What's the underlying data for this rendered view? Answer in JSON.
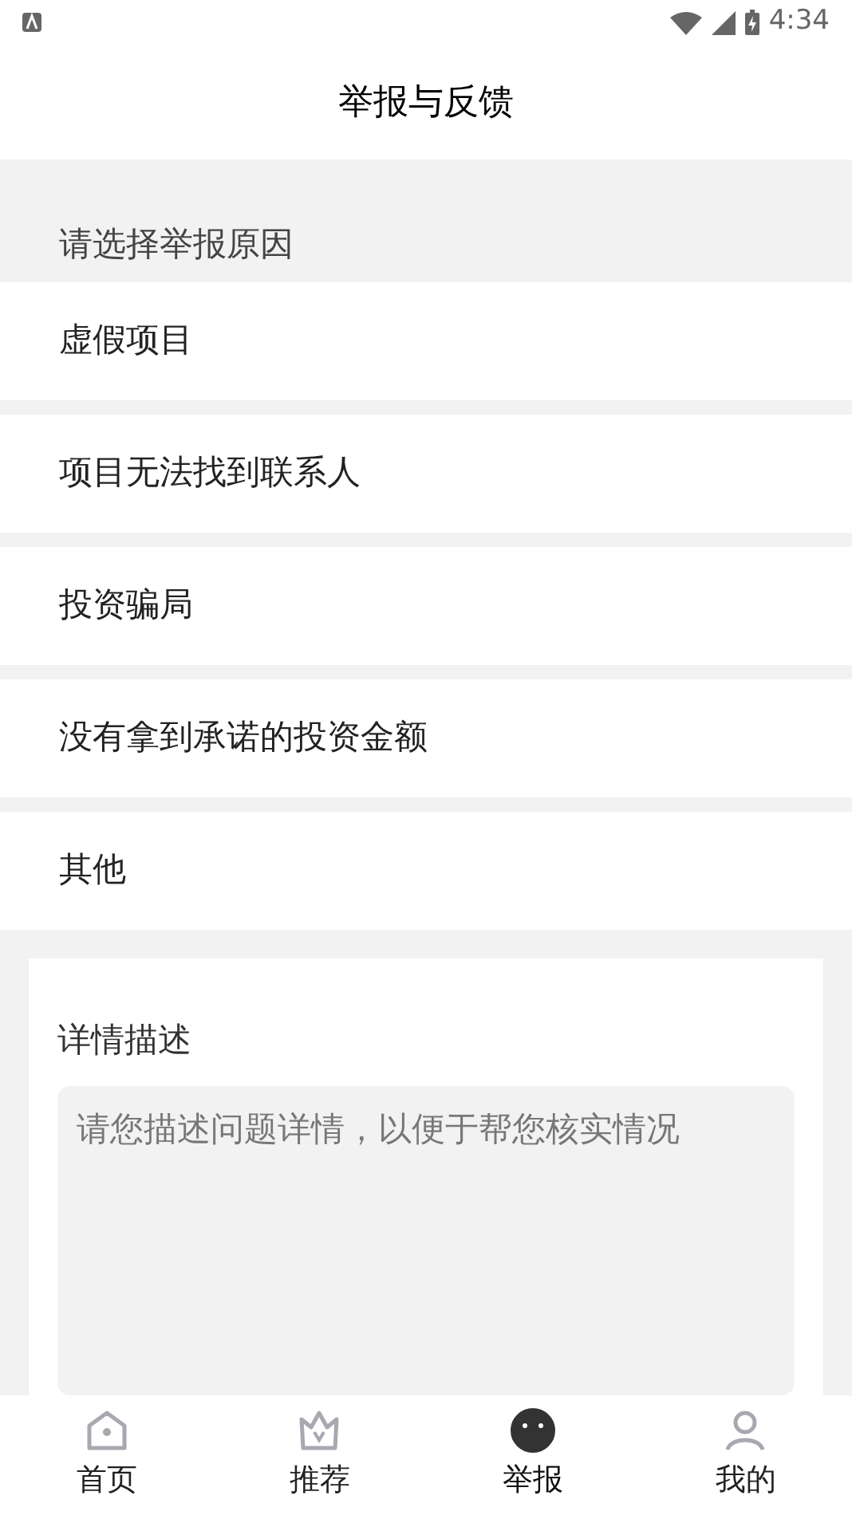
{
  "status_bar": {
    "time": "4:34"
  },
  "header": {
    "title": "举报与反馈"
  },
  "section_label": "请选择举报原因",
  "reasons": [
    {
      "label": "虚假项目"
    },
    {
      "label": "项目无法找到联系人"
    },
    {
      "label": "投资骗局"
    },
    {
      "label": "没有拿到承诺的投资金额"
    },
    {
      "label": "其他"
    }
  ],
  "details": {
    "label": "详情描述",
    "placeholder": "请您描述问题详情，以便于帮您核实情况"
  },
  "bottom_nav": [
    {
      "label": "首页",
      "kind": "home",
      "selected": false
    },
    {
      "label": "推荐",
      "kind": "crown",
      "selected": false
    },
    {
      "label": "举报",
      "kind": "report",
      "selected": true
    },
    {
      "label": "我的",
      "kind": "user",
      "selected": false
    }
  ]
}
